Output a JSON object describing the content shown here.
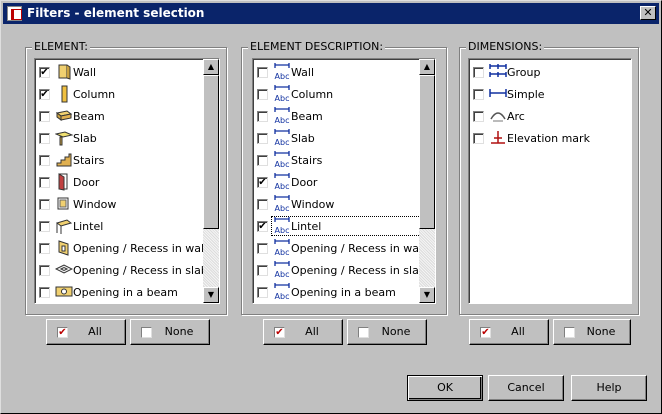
{
  "window": {
    "title": "Filters - element selection",
    "close_label": "✕"
  },
  "element": {
    "label": "ELEMENT:",
    "items": [
      {
        "label": "Wall",
        "checked": true,
        "icon": "wall-icon"
      },
      {
        "label": "Column",
        "checked": true,
        "icon": "column-icon"
      },
      {
        "label": "Beam",
        "checked": false,
        "icon": "beam-icon"
      },
      {
        "label": "Slab",
        "checked": false,
        "icon": "slab-icon"
      },
      {
        "label": "Stairs",
        "checked": false,
        "icon": "stairs-icon"
      },
      {
        "label": "Door",
        "checked": false,
        "icon": "door-icon"
      },
      {
        "label": "Window",
        "checked": false,
        "icon": "window-icon"
      },
      {
        "label": "Lintel",
        "checked": false,
        "icon": "lintel-icon"
      },
      {
        "label": "Opening / Recess in wall",
        "checked": false,
        "icon": "wall-opening-icon"
      },
      {
        "label": "Opening / Recess in slab",
        "checked": false,
        "icon": "slab-opening-icon"
      },
      {
        "label": "Opening in a beam",
        "checked": false,
        "icon": "beam-opening-icon"
      }
    ],
    "all_label": "All",
    "none_label": "None"
  },
  "description": {
    "label": "ELEMENT DESCRIPTION:",
    "items": [
      {
        "label": "Wall",
        "checked": false
      },
      {
        "label": "Column",
        "checked": false
      },
      {
        "label": "Beam",
        "checked": false
      },
      {
        "label": "Slab",
        "checked": false
      },
      {
        "label": "Stairs",
        "checked": false
      },
      {
        "label": "Door",
        "checked": true
      },
      {
        "label": "Window",
        "checked": false
      },
      {
        "label": "Lintel",
        "checked": true
      },
      {
        "label": "Opening / Recess in wall",
        "checked": false
      },
      {
        "label": "Opening / Recess in slab",
        "checked": false
      },
      {
        "label": "Opening in a beam",
        "checked": false
      }
    ],
    "icon_text": "Abc",
    "all_label": "All",
    "none_label": "None"
  },
  "dimensions": {
    "label": "DIMENSIONS:",
    "items": [
      {
        "label": "Group",
        "checked": false,
        "icon": "group-dimension-icon"
      },
      {
        "label": "Simple",
        "checked": false,
        "icon": "simple-dimension-icon"
      },
      {
        "label": "Arc",
        "checked": false,
        "icon": "arc-dimension-icon"
      },
      {
        "label": "Elevation mark",
        "checked": false,
        "icon": "elevation-mark-icon"
      }
    ],
    "all_label": "All",
    "none_label": "None"
  },
  "footer": {
    "ok_label": "OK",
    "cancel_label": "Cancel",
    "help_label": "Help"
  },
  "colors": {
    "titlebar": "#0a246a",
    "face": "#c0c0c0",
    "check_red": "#b00000"
  }
}
